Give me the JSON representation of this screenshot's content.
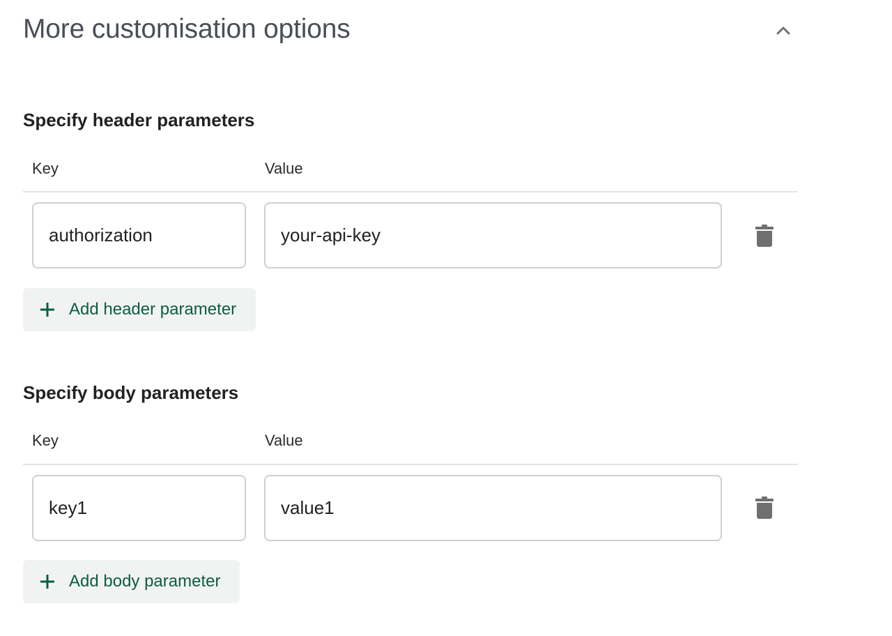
{
  "panel": {
    "title": "More customisation options",
    "collapse_icon": "chevron-up-icon",
    "expanded": true
  },
  "header_params": {
    "title": "Specify header parameters",
    "columns": {
      "key": "Key",
      "value": "Value"
    },
    "rows": [
      {
        "key": "authorization",
        "value": "your-api-key",
        "delete_icon": "trash-icon"
      }
    ],
    "add_label": "Add header parameter",
    "add_icon": "plus-icon"
  },
  "body_params": {
    "title": "Specify body parameters",
    "columns": {
      "key": "Key",
      "value": "Value"
    },
    "rows": [
      {
        "key": "key1",
        "value": "value1",
        "delete_icon": "trash-icon"
      }
    ],
    "add_label": "Add body parameter",
    "add_icon": "plus-icon"
  },
  "colors": {
    "accent": "#0d5c3f",
    "button_bg": "#f1f3f2",
    "title": "#4a4e57",
    "icon": "#6f6f6f"
  }
}
